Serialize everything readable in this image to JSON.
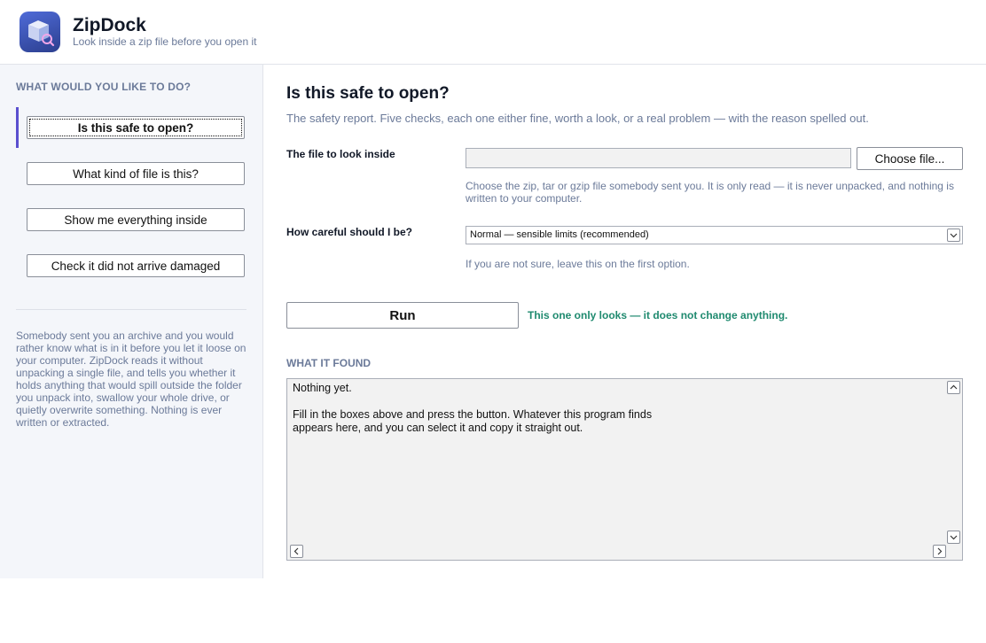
{
  "app": {
    "name": "ZipDock",
    "tagline": "Look inside a zip file before you open it",
    "icon": "package-magnifier-icon",
    "accent": "#5a4fcf",
    "success": "#1f8a6f"
  },
  "sidebar": {
    "heading": "WHAT WOULD YOU LIKE TO DO?",
    "items": [
      {
        "label": "Is this safe to open?",
        "active": true
      },
      {
        "label": "What kind of file is this?",
        "active": false
      },
      {
        "label": "Show me everything inside",
        "active": false
      },
      {
        "label": "Check it did not arrive damaged",
        "active": false
      }
    ],
    "description": "Somebody sent you an archive and you would rather know what is in it before you let it loose on your computer. ZipDock reads it without unpacking a single file, and tells you whether it holds anything that would spill outside the folder you unpack into, swallow your whole drive, or quietly overwrite something. Nothing is ever written or extracted."
  },
  "main": {
    "title": "Is this safe to open?",
    "subtitle": "The safety report. Five checks, each one either fine, worth a look, or a real problem — with the reason spelled out.",
    "file_field": {
      "label": "The file to look inside",
      "value": "",
      "button": "Choose file...",
      "hint": "Choose the zip, tar or gzip file somebody sent you. It is only read — it is never unpacked, and nothing is written to your computer."
    },
    "care_field": {
      "label": "How careful should I be?",
      "selected": "Normal — sensible limits (recommended)",
      "hint": "If you are not sure, leave this on the first option."
    },
    "run": {
      "label": "Run",
      "note": "This one only looks — it does not change anything."
    },
    "output": {
      "heading": "WHAT IT FOUND",
      "text": "Nothing yet.\n\nFill in the boxes above and press the button. Whatever this program finds\nappears here, and you can select it and copy it straight out."
    }
  }
}
